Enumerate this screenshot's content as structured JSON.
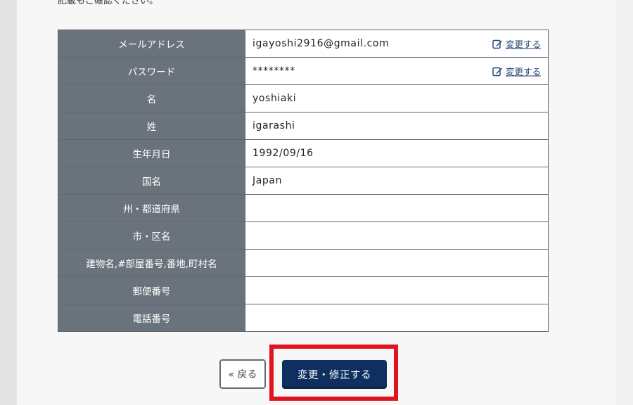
{
  "intro_text": "記載もご確認ください。",
  "rows": [
    {
      "label": "メールアドレス",
      "value": "igayoshi2916@gmail.com",
      "change": "変更する"
    },
    {
      "label": "パスワード",
      "value": "********",
      "change": "変更する"
    },
    {
      "label": "名",
      "value": "yoshiaki"
    },
    {
      "label": "姓",
      "value": "igarashi"
    },
    {
      "label": "生年月日",
      "value": "1992/09/16"
    },
    {
      "label": "国名",
      "value": "Japan"
    },
    {
      "label": "州・都道府県",
      "value": ""
    },
    {
      "label": "市・区名",
      "value": ""
    },
    {
      "label": "建物名,#部屋番号,番地,町村名",
      "value": ""
    },
    {
      "label": "郵便番号",
      "value": ""
    },
    {
      "label": "電話番号",
      "value": ""
    }
  ],
  "buttons": {
    "back_label": "« 戻る",
    "submit_label": "変更・修正する"
  },
  "colors": {
    "label_bg": "#6a737c",
    "submit_bg": "#0e2f5f",
    "highlight": "#e0141e",
    "link": "#1f3f75"
  }
}
